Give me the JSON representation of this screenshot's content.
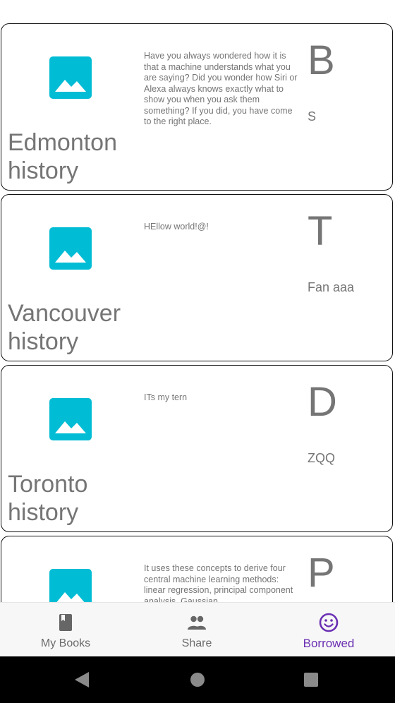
{
  "books": [
    {
      "title": "Edmonton history",
      "description": "Have you always wondered how it is that a machine understands what you are saying? Did you wonder how Siri or Alexa always knows exactly what to show you when you ask them something? If you did, you have come to the right place.",
      "letter": "B",
      "owner": "S",
      "thumbnail_icon": "image-icon"
    },
    {
      "title": "Vancouver history",
      "description": "HEllow world!@!",
      "letter": "T",
      "owner": "Fan aaa",
      "thumbnail_icon": "image-icon"
    },
    {
      "title": "Toronto history",
      "description": "ITs my tern",
      "letter": "D",
      "owner": "ZQQ",
      "thumbnail_icon": "image-icon"
    },
    {
      "title": "",
      "description": "It uses these concepts to derive four central machine learning methods: linear regression, principal component analysis, Gaussian",
      "letter": "P",
      "owner": "",
      "thumbnail_icon": "image-icon"
    }
  ],
  "bottom_nav": {
    "items": [
      {
        "label": "My Books",
        "icon": "book-icon",
        "active": false
      },
      {
        "label": "Share",
        "icon": "people-icon",
        "active": false
      },
      {
        "label": "Borrowed",
        "icon": "smiley-icon",
        "active": true
      }
    ]
  },
  "system_nav": {
    "back_icon": "back-triangle-icon",
    "home_icon": "home-circle-icon",
    "recents_icon": "recents-square-icon"
  },
  "colors": {
    "thumbnail": "#00bcd4",
    "text_gray": "#757575",
    "active_accent": "#6a2fb3",
    "nav_background": "#f7f7f7"
  }
}
